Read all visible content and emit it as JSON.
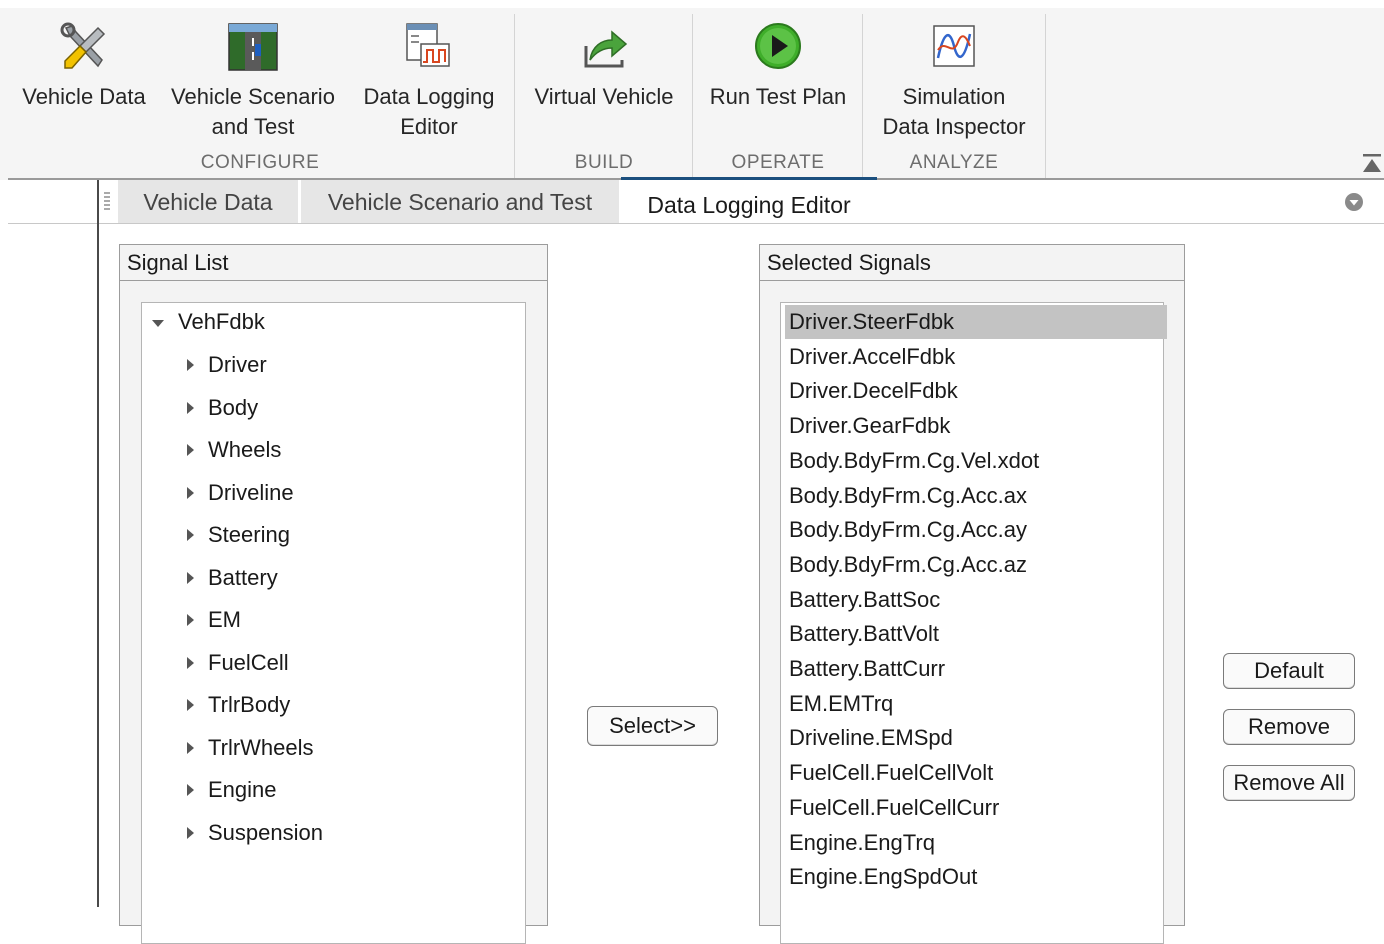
{
  "toolstrip": {
    "tools": [
      {
        "id": "vehicle-data",
        "label_line1": "Vehicle Data",
        "label_line2": "",
        "icon": "wrench-screwdriver-icon"
      },
      {
        "id": "vehicle-scenario",
        "label_line1": "Vehicle Scenario",
        "label_line2": "and Test",
        "icon": "road-scene-icon"
      },
      {
        "id": "data-logging",
        "label_line1": "Data Logging",
        "label_line2": "Editor",
        "icon": "signal-logging-icon"
      },
      {
        "id": "virtual-vehicle",
        "label_line1": "Virtual Vehicle",
        "label_line2": "",
        "icon": "build-arrow-icon"
      },
      {
        "id": "run-test-plan",
        "label_line1": "Run Test Plan",
        "label_line2": "",
        "icon": "play-icon"
      },
      {
        "id": "sdi",
        "label_line1": "Simulation",
        "label_line2": "Data Inspector",
        "icon": "waveform-icon"
      }
    ],
    "sections": [
      "CONFIGURE",
      "BUILD",
      "OPERATE",
      "ANALYZE"
    ],
    "collapse_icon": "collapse-toolstrip-icon"
  },
  "tabs": [
    {
      "label": "Vehicle Data",
      "active": false
    },
    {
      "label": "Vehicle Scenario and Test",
      "active": false
    },
    {
      "label": "Data Logging Editor",
      "active": true
    }
  ],
  "signal_list": {
    "title": "Signal List",
    "root": "VehFdbk",
    "children": [
      "Driver",
      "Body",
      "Wheels",
      "Driveline",
      "Steering",
      "Battery",
      "EM",
      "FuelCell",
      "TrlrBody",
      "TrlrWheels",
      "Engine",
      "Suspension"
    ]
  },
  "select_button": "Select>>",
  "selected_signals": {
    "title": "Selected Signals",
    "items": [
      "Driver.SteerFdbk",
      "Driver.AccelFdbk",
      "Driver.DecelFdbk",
      "Driver.GearFdbk",
      "Body.BdyFrm.Cg.Vel.xdot",
      "Body.BdyFrm.Cg.Acc.ax",
      "Body.BdyFrm.Cg.Acc.ay",
      "Body.BdyFrm.Cg.Acc.az",
      "Battery.BattSoc",
      "Battery.BattVolt",
      "Battery.BattCurr",
      "EM.EMTrq",
      "Driveline.EMSpd",
      "FuelCell.FuelCellVolt",
      "FuelCell.FuelCellCurr",
      "Engine.EngTrq",
      "Engine.EngSpdOut"
    ],
    "selected_index": 0
  },
  "actions": {
    "default": "Default",
    "remove": "Remove",
    "remove_all": "Remove All"
  },
  "colors": {
    "active_tab_accent": "#1b4f7e",
    "selected_row": "#c3c3c3",
    "play_green": "#3fae2a"
  }
}
